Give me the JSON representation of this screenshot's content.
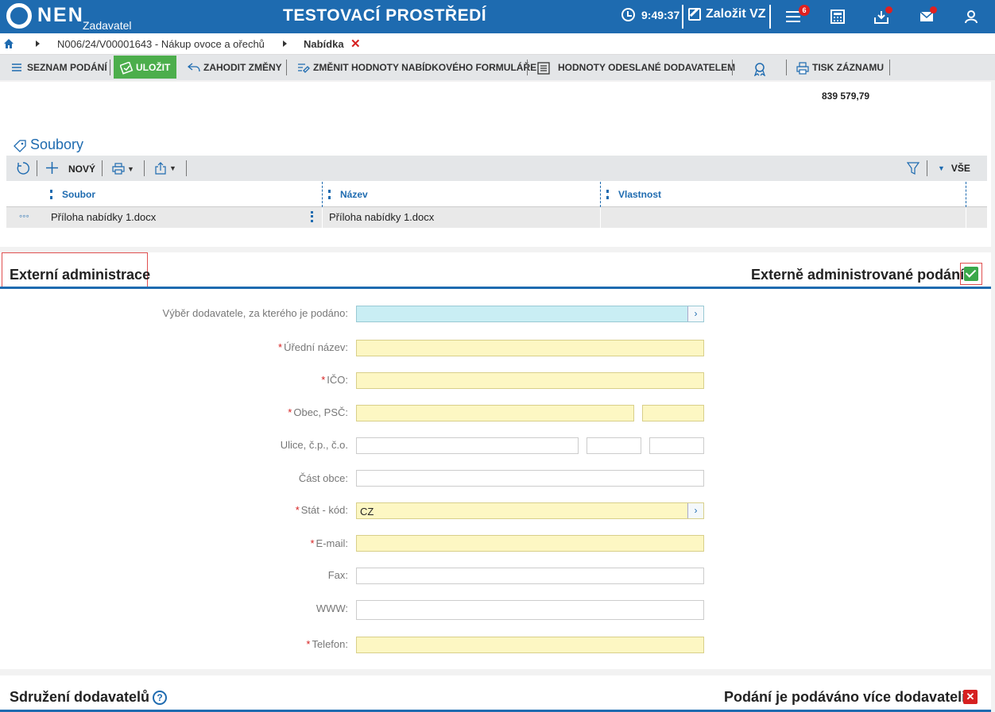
{
  "header": {
    "logo_text": "NEN",
    "logo_sub": "Zadavatel",
    "env_title": "TESTOVACÍ PROSTŘEDÍ",
    "clock": "9:49:37",
    "create_label": "Založit VZ",
    "menu_badge": "6"
  },
  "breadcrumb": {
    "item1": "N006/24/V00001643 - Nákup ovoce a ořechů",
    "item2": "Nabídka",
    "close": "✕"
  },
  "toolbar": {
    "list_label": "SEZNAM PODÁNÍ",
    "save_label": "ULOŽIT",
    "discard_label": "ZAHODIT ZMĚNY",
    "change_label": "ZMĚNIT HODNOTY NABÍDKOVÉHO FORMULÁŘE",
    "sent_label": "HODNOTY ODESLANÉ DODAVATELEM",
    "print_label": "TISK ZÁZNAMU"
  },
  "amount": "839 579,79",
  "files": {
    "title": "Soubory",
    "new_label": "NOVÝ",
    "all_label": "VŠE",
    "columns": [
      "Soubor",
      "Název",
      "Vlastnost"
    ],
    "rows": [
      {
        "more": "◦◦◦",
        "file": "Příloha nabídky 1.docx",
        "name": "Příloha nabídky 1.docx",
        "property": ""
      }
    ]
  },
  "external": {
    "title": "Externí administrace",
    "toggle_label": "Externě administrované podání:",
    "fields": {
      "supplier_label": "Výběr dodavatele, za kterého je podáno:",
      "official_name_label": "Úřední název:",
      "ico_label": "IČO:",
      "city_label": "Obec, PSČ:",
      "street_label": "Ulice, č.p., č.o.",
      "district_label": "Část obce:",
      "country_label": "Stát - kód:",
      "country_value": "CZ",
      "email_label": "E-mail:",
      "fax_label": "Fax:",
      "www_label": "WWW:",
      "phone_label": "Telefon:",
      "required_mark": "*"
    }
  },
  "association": {
    "title": "Sdružení dodavatelů",
    "help": "?",
    "toggle_label": "Podání je podáváno více dodavateli:",
    "toggle_value": "✕"
  },
  "colors": {
    "brand_blue": "#1e6bb0",
    "save_green": "#4cae4c",
    "required_yellow": "#fdf7c3",
    "lookup_cyan": "#c9eef4",
    "danger_red": "#d62020"
  }
}
